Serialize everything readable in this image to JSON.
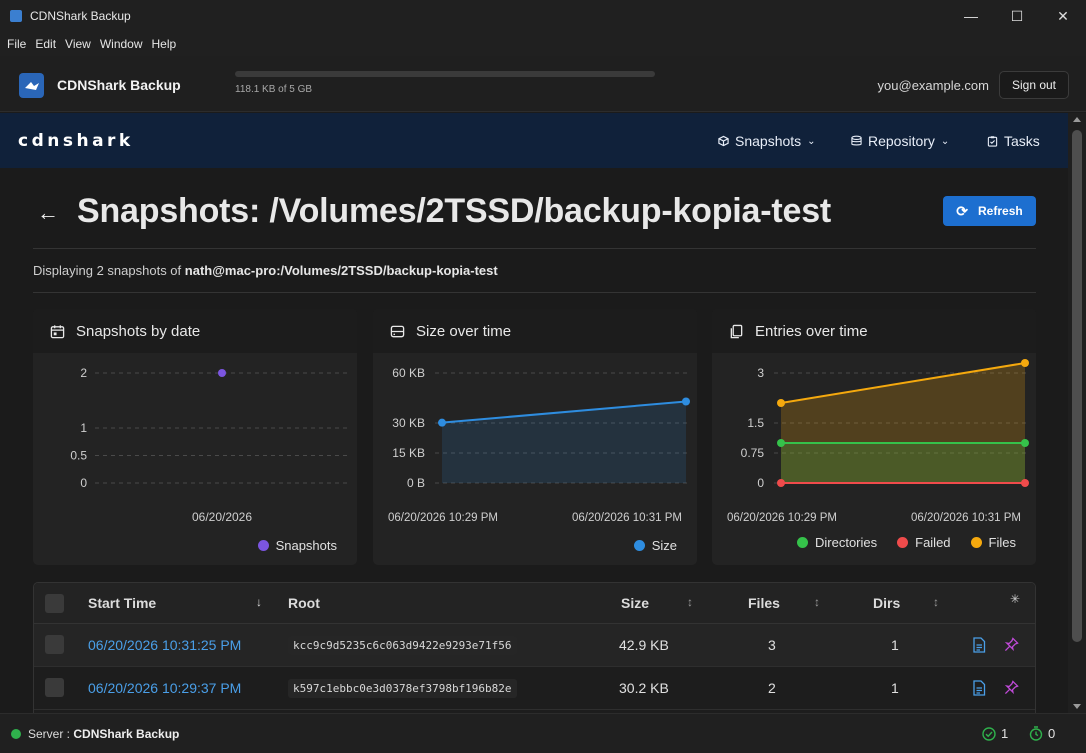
{
  "window": {
    "title": "CDNShark Backup",
    "controls": [
      "minimize",
      "maximize",
      "close"
    ]
  },
  "menu": [
    "File",
    "Edit",
    "View",
    "Window",
    "Help"
  ],
  "header": {
    "app_name": "CDNShark Backup",
    "quota_text": "118.1 KB of 5 GB",
    "quota_fraction": 2e-05,
    "user_email": "you@example.com",
    "signout_label": "Sign out"
  },
  "nav": {
    "brand": "cdnshark",
    "items": [
      {
        "label": "Snapshots",
        "icon": "cube-icon",
        "dropdown": true
      },
      {
        "label": "Repository",
        "icon": "database-icon",
        "dropdown": true
      },
      {
        "label": "Tasks",
        "icon": "clipboard-icon",
        "dropdown": false
      }
    ]
  },
  "page": {
    "title": "Snapshots: /Volumes/2TSSD/backup-kopia-test",
    "refresh_label": "Refresh",
    "subtext_prefix": "Displaying 2 snapshots of",
    "subtext_source": "nath@mac-pro:/Volumes/2TSSD/backup-kopia-test"
  },
  "cards": [
    {
      "title": "Snapshots by date",
      "icon": "calendar-icon"
    },
    {
      "title": "Size over time",
      "icon": "hard-drive-icon"
    },
    {
      "title": "Entries over time",
      "icon": "copy-icon"
    }
  ],
  "chart_data": [
    {
      "type": "scatter",
      "title": "Snapshots by date",
      "x": [
        "06/20/2026"
      ],
      "series": [
        {
          "name": "Snapshots",
          "color": "#7b55e0",
          "values": [
            2
          ]
        }
      ],
      "y_ticks": [
        "0",
        "0.5",
        "1",
        "2"
      ],
      "x_ticks": [
        "06/20/2026"
      ],
      "ylim": [
        0,
        2
      ],
      "legend": "bottom-right"
    },
    {
      "type": "area",
      "title": "Size over time",
      "x": [
        "06/20/2026 10:29 PM",
        "06/20/2026 10:31 PM"
      ],
      "series": [
        {
          "name": "Size",
          "color": "#2e8de0",
          "values_kb": [
            30.2,
            42.9
          ]
        }
      ],
      "y_ticks": [
        "0 B",
        "15 KB",
        "30 KB",
        "60 KB"
      ],
      "x_ticks": [
        "06/20/2026 10:29 PM",
        "06/20/2026 10:31 PM"
      ],
      "legend": "bottom-right"
    },
    {
      "type": "area",
      "title": "Entries over time",
      "x": [
        "06/20/2026 10:29 PM",
        "06/20/2026 10:31 PM"
      ],
      "series": [
        {
          "name": "Directories",
          "color": "#35c24a",
          "values": [
            1,
            1
          ]
        },
        {
          "name": "Failed",
          "color": "#ef4b4b",
          "values": [
            0,
            0
          ]
        },
        {
          "name": "Files",
          "color": "#f5a90e",
          "values": [
            2,
            3
          ]
        }
      ],
      "y_ticks": [
        "0",
        "0.75",
        "1.5",
        "3"
      ],
      "x_ticks": [
        "06/20/2026 10:29 PM",
        "06/20/2026 10:31 PM"
      ],
      "legend": "bottom-right"
    }
  ],
  "table": {
    "columns": [
      "Start Time",
      "Root",
      "Size",
      "Files",
      "Dirs"
    ],
    "rows": [
      {
        "start_time": "06/20/2026 10:31:25 PM",
        "root": "kcc9c9d5235c6c063d9422e9293e71f56",
        "size": "42.9 KB",
        "files": "3",
        "dirs": "1"
      },
      {
        "start_time": "06/20/2026 10:29:37 PM",
        "root": "k597c1ebbc0e3d0378ef3798bf196b82e",
        "size": "30.2 KB",
        "files": "2",
        "dirs": "1"
      }
    ]
  },
  "status": {
    "server_label": "Server :",
    "server_name": "CDNShark Backup",
    "running_count": "1",
    "pending_count": "0",
    "colors": {
      "ok": "#2fb14c",
      "accent": "#1d6fd0"
    }
  }
}
